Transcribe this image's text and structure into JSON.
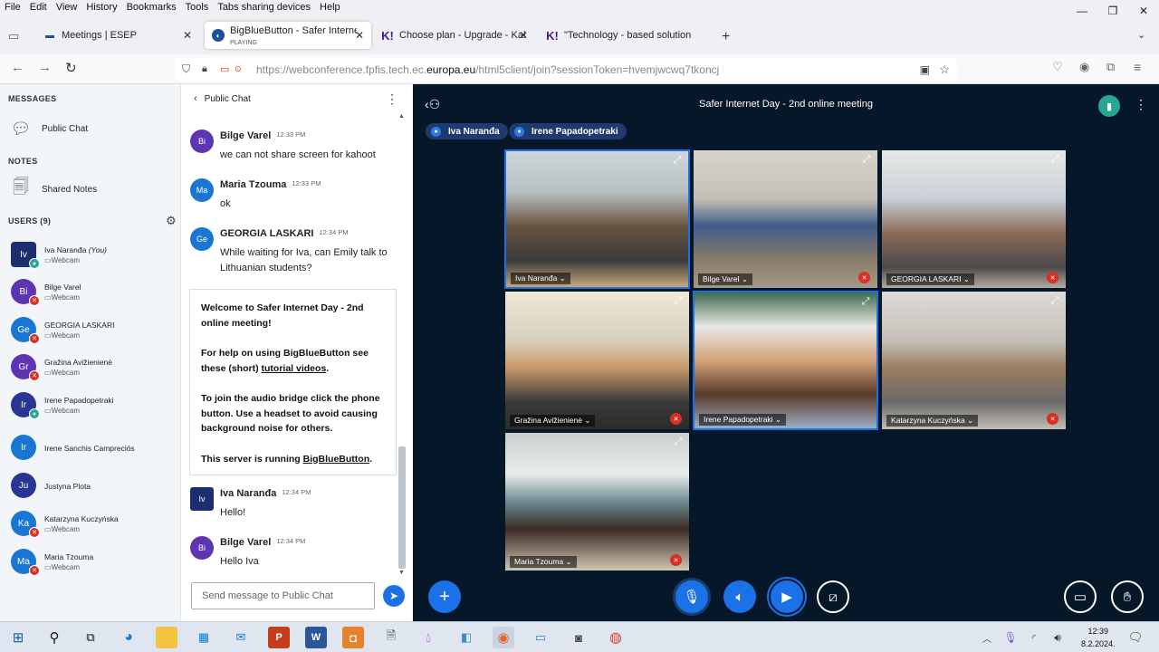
{
  "menu": [
    "File",
    "Edit",
    "View",
    "History",
    "Bookmarks",
    "Tools",
    "Tabs sharing devices",
    "Help"
  ],
  "window_controls": {
    "minimize": "—",
    "restore": "❐",
    "close": "✕"
  },
  "tabs": [
    {
      "title": "Meetings | ESEP",
      "icon": "esep-icon"
    },
    {
      "title": "BigBlueButton - Safer Internet D",
      "sub": "PLAYING",
      "icon": "bbb-icon"
    },
    {
      "title": "Choose plan - Upgrade - Kahoot",
      "icon": "kahoot-icon"
    },
    {
      "title": "\"Technology - based solutions t",
      "icon": "kahoot-icon"
    }
  ],
  "url": {
    "prefix": "https://webconference.fpfis.tech.ec.",
    "host": "europa.eu",
    "suffix": "/html5client/join?sessionToken=hvemjwcwq7tkoncj"
  },
  "sidebar": {
    "messages_header": "MESSAGES",
    "public_chat": "Public Chat",
    "notes_header": "NOTES",
    "shared_notes": "Shared Notes",
    "users_header": "USERS (9)",
    "users": [
      {
        "initials": "Iv",
        "name": "Iva Naranđa",
        "you": "(You)",
        "status": "Webcam",
        "color": "#1c2e6e",
        "square": true,
        "badge": "#26a693"
      },
      {
        "initials": "Bi",
        "name": "Bilge Varel",
        "status": "Webcam",
        "color": "#5e35b1",
        "badge": "#d93025"
      },
      {
        "initials": "Ge",
        "name": "GEORGIA LASKARI",
        "status": "Webcam",
        "color": "#1976d2",
        "badge": "#d93025"
      },
      {
        "initials": "Gr",
        "name": "Gražina Avižienienė",
        "status": "Webcam",
        "color": "#5e35b1",
        "badge": "#d93025"
      },
      {
        "initials": "Ir",
        "name": "Irene Papadopetraki",
        "status": "Webcam",
        "color": "#283593",
        "badge": "#26a693"
      },
      {
        "initials": "Ir",
        "name": "Irene Sanchis Campreciós",
        "status": "",
        "color": "#1976d2"
      },
      {
        "initials": "Ju",
        "name": "Justyna Plota",
        "status": "",
        "color": "#283593"
      },
      {
        "initials": "Ka",
        "name": "Katarzyna Kuczyńska",
        "status": "Webcam",
        "color": "#1976d2",
        "badge": "#d93025"
      },
      {
        "initials": "Ma",
        "name": "Maria Tzouma",
        "status": "Webcam",
        "color": "#1976d2",
        "badge": "#d93025"
      }
    ]
  },
  "chat": {
    "title": "Public Chat",
    "messages_top": [
      {
        "initials": "Bi",
        "name": "Bilge Varel",
        "time": "12:33 PM",
        "text": "we can not share screen for kahoot",
        "color": "#5e35b1"
      },
      {
        "initials": "Ma",
        "name": "Maria Tzouma",
        "time": "12:33 PM",
        "text": "ok",
        "color": "#1976d2"
      },
      {
        "initials": "Ge",
        "name": "GEORGIA LASKARI",
        "time": "12:34 PM",
        "text": "While waiting for Iva, can Emily talk to Lithuanian students?",
        "color": "#1976d2"
      }
    ],
    "welcome": {
      "l1a": "Welcome to ",
      "l1b": "Safer Internet Day - 2nd online meeting!",
      "l2a": "For help on using BigBlueButton see these (short) ",
      "l2link": "tutorial videos",
      "l2b": ".",
      "l3": "To join the audio bridge click the phone button. Use a headset to avoid causing background noise for others.",
      "l4a": "This server is running ",
      "l4link": "BigBlueButton",
      "l4b": "."
    },
    "messages_bottom": [
      {
        "initials": "Iv",
        "name": "Iva Naranđa",
        "time": "12:34 PM",
        "text": "Hello!",
        "color": "#1c2e6e",
        "square": true
      },
      {
        "initials": "Bi",
        "name": "Bilge Varel",
        "time": "12:34 PM",
        "text": "Hello Iva",
        "color": "#5e35b1"
      }
    ],
    "input_placeholder": "Send message to Public Chat"
  },
  "meeting": {
    "title": "Safer Internet Day - 2nd online meeting",
    "talkers": [
      "Iva Naranđa",
      "Irene Papadopetraki"
    ],
    "tiles": [
      {
        "name": "Iva Naranđa",
        "muted": false,
        "active": true
      },
      {
        "name": "Bilge Varel",
        "muted": true
      },
      {
        "name": "GEORGIA LASKARI",
        "muted": true
      },
      {
        "name": "Gražina Avižienienė",
        "muted": true
      },
      {
        "name": "Irene Papadopetraki",
        "muted": false,
        "active": true
      },
      {
        "name": "Katarzyna Kuczyńska",
        "muted": true
      },
      {
        "name": "Maria Tzouma",
        "muted": true
      }
    ]
  },
  "clock": {
    "time": "12:39",
    "date": "8.2.2024."
  }
}
